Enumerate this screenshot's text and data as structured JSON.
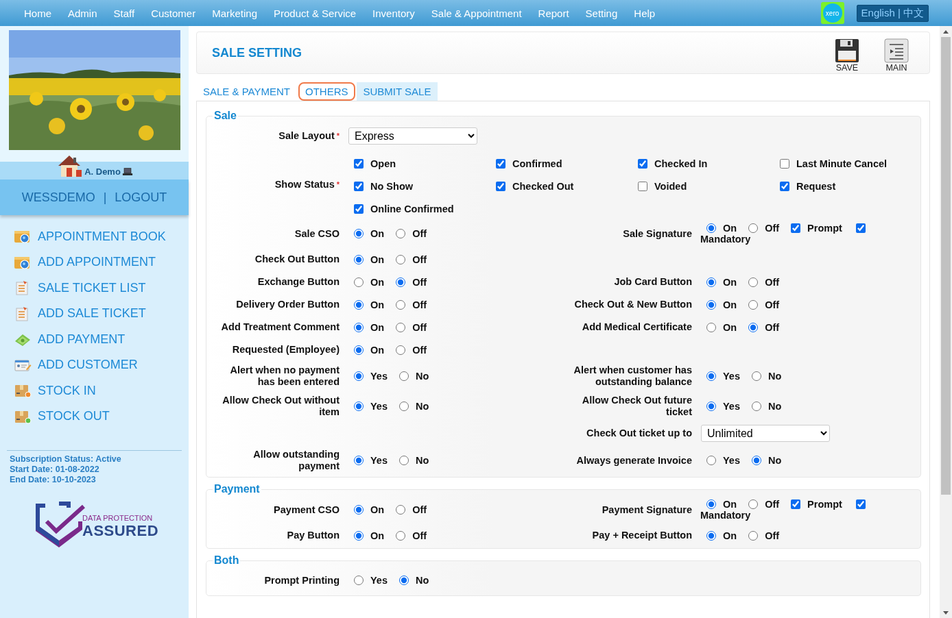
{
  "nav": {
    "items": [
      "Home",
      "Admin",
      "Staff",
      "Customer",
      "Marketing",
      "Product & Service",
      "Inventory",
      "Sale & Appointment",
      "Report",
      "Setting",
      "Help"
    ],
    "brand": "xero",
    "language": "English | 中文"
  },
  "sidebar": {
    "user": "A. Demo",
    "links": [
      "WESSDEMO",
      "LOGOUT"
    ],
    "separator": "|",
    "menu": [
      {
        "label": "APPOINTMENT BOOK",
        "kind": "appointment"
      },
      {
        "label": "ADD APPOINTMENT",
        "kind": "appointment"
      },
      {
        "label": "SALE TICKET LIST",
        "kind": "ticket"
      },
      {
        "label": "ADD SALE TICKET",
        "kind": "ticket"
      },
      {
        "label": "ADD PAYMENT",
        "kind": "payment"
      },
      {
        "label": "ADD CUSTOMER",
        "kind": "customer"
      },
      {
        "label": "STOCK IN",
        "kind": "stockin"
      },
      {
        "label": "STOCK OUT",
        "kind": "stockout"
      }
    ],
    "subscription": [
      "Subscription Status: Active",
      "Start Date: 01-08-2022",
      "End Date: 10-10-2023"
    ],
    "badge": {
      "top": "DATA PROTECTION",
      "bottom": "ASSURED"
    }
  },
  "header": {
    "title": "SALE SETTING",
    "actions": [
      {
        "label": "SAVE",
        "kind": "save"
      },
      {
        "label": "MAIN",
        "kind": "main"
      }
    ]
  },
  "tabs": [
    {
      "label": "SALE & PAYMENT",
      "selected": true,
      "highlighted": false
    },
    {
      "label": "OTHERS",
      "selected": false,
      "highlighted": true
    },
    {
      "label": "SUBMIT SALE",
      "selected": false,
      "highlighted": false
    }
  ],
  "sections": [
    {
      "title": "Sale",
      "rows": [
        {
          "left": {
            "label": "Sale Layout",
            "required": "*",
            "kind": "select",
            "value": "Express"
          }
        },
        {
          "left": {
            "label": "Show Status",
            "required": "*",
            "kind": "checkboxes",
            "options": [
              {
                "label": "Open",
                "checked": true
              },
              {
                "label": "Confirmed",
                "checked": true
              },
              {
                "label": "Checked In",
                "checked": true
              },
              {
                "label": "Last Minute Cancel",
                "checked": false
              },
              {
                "label": "No Show",
                "checked": true
              },
              {
                "label": "Checked Out",
                "checked": true
              },
              {
                "label": "Voided",
                "checked": false
              },
              {
                "label": "Request",
                "checked": true
              },
              {
                "label": "Online Confirmed",
                "checked": true
              }
            ]
          }
        },
        {
          "left": {
            "label": "Sale CSO",
            "kind": "radio",
            "options": [
              {
                "label": "On",
                "selected": true
              },
              {
                "label": "Off",
                "selected": false
              }
            ]
          },
          "right": {
            "label": "Sale Signature",
            "kind": "signature",
            "options": [
              {
                "label": "On",
                "selected": true
              },
              {
                "label": "Off",
                "selected": false
              }
            ],
            "prompt": {
              "label": "Prompt",
              "checked": true
            },
            "mandatory": {
              "label": "Mandatory",
              "checked": true
            }
          }
        },
        {
          "left": {
            "label": "Check Out Button",
            "kind": "radio",
            "options": [
              {
                "label": "On",
                "selected": true
              },
              {
                "label": "Off",
                "selected": false
              }
            ]
          }
        },
        {
          "left": {
            "label": "Exchange Button",
            "kind": "radio",
            "options": [
              {
                "label": "On",
                "selected": false
              },
              {
                "label": "Off",
                "selected": true
              }
            ]
          },
          "right": {
            "label": "Job Card Button",
            "kind": "radio",
            "options": [
              {
                "label": "On",
                "selected": true
              },
              {
                "label": "Off",
                "selected": false
              }
            ]
          }
        },
        {
          "left": {
            "label": "Delivery Order Button",
            "kind": "radio",
            "options": [
              {
                "label": "On",
                "selected": true
              },
              {
                "label": "Off",
                "selected": false
              }
            ]
          },
          "right": {
            "label": "Check Out & New Button",
            "kind": "radio",
            "options": [
              {
                "label": "On",
                "selected": true
              },
              {
                "label": "Off",
                "selected": false
              }
            ]
          }
        },
        {
          "left": {
            "label": "Add Treatment Comment",
            "kind": "radio",
            "options": [
              {
                "label": "On",
                "selected": true
              },
              {
                "label": "Off",
                "selected": false
              }
            ]
          },
          "right": {
            "label": "Add Medical Certificate",
            "kind": "radio",
            "options": [
              {
                "label": "On",
                "selected": false
              },
              {
                "label": "Off",
                "selected": true
              }
            ]
          }
        },
        {
          "left": {
            "label": "Requested (Employee)",
            "kind": "radio",
            "options": [
              {
                "label": "On",
                "selected": true
              },
              {
                "label": "Off",
                "selected": false
              }
            ]
          }
        },
        {
          "left": {
            "label": "Alert when no payment has been entered",
            "kind": "radio",
            "options": [
              {
                "label": "Yes",
                "selected": true
              },
              {
                "label": "No",
                "selected": false
              }
            ]
          },
          "right": {
            "label": "Alert when customer has outstanding balance",
            "kind": "radio",
            "options": [
              {
                "label": "Yes",
                "selected": true
              },
              {
                "label": "No",
                "selected": false
              }
            ]
          }
        },
        {
          "left": {
            "label": "Allow Check Out without item",
            "kind": "radio",
            "options": [
              {
                "label": "Yes",
                "selected": true
              },
              {
                "label": "No",
                "selected": false
              }
            ]
          },
          "right": {
            "label": "Allow Check Out future ticket",
            "kind": "radio",
            "options": [
              {
                "label": "Yes",
                "selected": true
              },
              {
                "label": "No",
                "selected": false
              }
            ]
          }
        },
        {
          "right": {
            "label": "Check Out ticket up to",
            "kind": "select",
            "value": "Unlimited"
          }
        },
        {
          "left": {
            "label": "Allow outstanding payment",
            "kind": "radio",
            "options": [
              {
                "label": "Yes",
                "selected": true
              },
              {
                "label": "No",
                "selected": false
              }
            ]
          },
          "right": {
            "label": "Always generate Invoice",
            "kind": "radio",
            "options": [
              {
                "label": "Yes",
                "selected": false
              },
              {
                "label": "No",
                "selected": true
              }
            ]
          }
        }
      ]
    },
    {
      "title": "Payment",
      "rows": [
        {
          "left": {
            "label": "Payment CSO",
            "kind": "radio",
            "options": [
              {
                "label": "On",
                "selected": true
              },
              {
                "label": "Off",
                "selected": false
              }
            ]
          },
          "right": {
            "label": "Payment Signature",
            "kind": "signature",
            "options": [
              {
                "label": "On",
                "selected": true
              },
              {
                "label": "Off",
                "selected": false
              }
            ],
            "prompt": {
              "label": "Prompt",
              "checked": true
            },
            "mandatory": {
              "label": "Mandatory",
              "checked": true
            }
          }
        },
        {
          "left": {
            "label": "Pay Button",
            "kind": "radio",
            "options": [
              {
                "label": "On",
                "selected": true
              },
              {
                "label": "Off",
                "selected": false
              }
            ]
          },
          "right": {
            "label": "Pay + Receipt Button",
            "kind": "radio",
            "options": [
              {
                "label": "On",
                "selected": true
              },
              {
                "label": "Off",
                "selected": false
              }
            ]
          }
        }
      ]
    },
    {
      "title": "Both",
      "rows": [
        {
          "left": {
            "label": "Prompt Printing",
            "kind": "radio",
            "options": [
              {
                "label": "Yes",
                "selected": false
              },
              {
                "label": "No",
                "selected": true
              }
            ]
          }
        }
      ]
    }
  ]
}
